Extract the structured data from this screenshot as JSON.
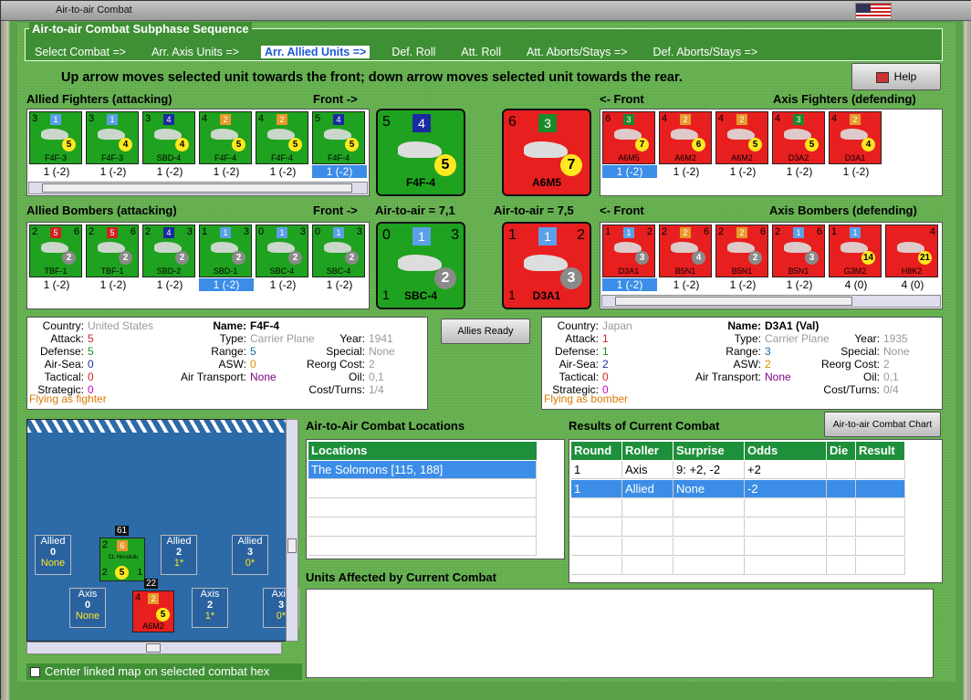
{
  "window": {
    "title": "Air-to-air Combat"
  },
  "sequence": {
    "header": "Air-to-air Combat Subphase Sequence",
    "steps": [
      "Select Combat =>",
      "Arr. Axis Units =>",
      "Arr. Allied Units =>",
      "Def. Roll",
      "Att. Roll",
      "Att. Aborts/Stays =>",
      "Def. Aborts/Stays =>"
    ],
    "active": 2
  },
  "instruction": "Up arrow moves selected unit towards the front; down arrow moves selected unit towards the rear.",
  "help_label": "Help",
  "labels": {
    "allied_fighters": "Allied Fighters (attacking)",
    "front_right": "Front ->",
    "front_left": "<- Front",
    "axis_fighters": "Axis Fighters (defending)",
    "allied_bombers": "Allied Bombers (attacking)",
    "axis_bombers": "Axis Bombers (defending)",
    "allied_a2a": "Air-to-air = 7,1",
    "axis_a2a": "Air-to-air = 7,5"
  },
  "allied_fighters": [
    {
      "tl": "3",
      "tr": "",
      "sq": "1",
      "name": "F4F-3",
      "circle": "5",
      "odds": "1 (-2)"
    },
    {
      "tl": "3",
      "tr": "",
      "sq": "1",
      "name": "F4F-3",
      "circle": "4",
      "odds": "1 (-2)"
    },
    {
      "tl": "3",
      "tr": "",
      "sq": "4",
      "name": "SBD-4",
      "circle": "4",
      "odds": "1 (-2)"
    },
    {
      "tl": "4",
      "tr": "",
      "sq": "2",
      "name": "F4F-4",
      "circle": "5",
      "odds": "1 (-2)"
    },
    {
      "tl": "4",
      "tr": "",
      "sq": "2",
      "name": "F4F-4",
      "circle": "5",
      "odds": "1 (-2)"
    },
    {
      "tl": "5",
      "tr": "",
      "sq": "4",
      "name": "F4F-4",
      "circle": "5",
      "odds": "1 (-2)"
    }
  ],
  "allied_bombers": [
    {
      "tl": "2",
      "tr": "6",
      "sq": "5",
      "name": "TBF-1",
      "circle": "2",
      "odds": "1 (-2)"
    },
    {
      "tl": "2",
      "tr": "6",
      "sq": "5",
      "name": "TBF-1",
      "circle": "2",
      "odds": "1 (-2)"
    },
    {
      "tl": "2",
      "tr": "3",
      "sq": "4",
      "name": "SBD-2",
      "circle": "2",
      "odds": "1 (-2)"
    },
    {
      "tl": "1",
      "tr": "3",
      "sq": "1",
      "name": "SBD-1",
      "circle": "2",
      "odds": "1 (-2)"
    },
    {
      "tl": "0",
      "tr": "3",
      "sq": "1",
      "name": "SBC-4",
      "circle": "2",
      "odds": "1 (-2)"
    },
    {
      "tl": "0",
      "tr": "3",
      "sq": "1",
      "name": "SBC-4",
      "circle": "2",
      "odds": "1 (-2)"
    }
  ],
  "axis_fighters": [
    {
      "tl": "6",
      "tr": "",
      "sq": "3",
      "name": "A6M5",
      "circle": "7",
      "odds": "1 (-2)"
    },
    {
      "tl": "4",
      "tr": "",
      "sq": "2",
      "name": "A6M2",
      "circle": "6",
      "odds": "1 (-2)"
    },
    {
      "tl": "4",
      "tr": "",
      "sq": "2",
      "name": "A6M2",
      "circle": "5",
      "odds": "1 (-2)"
    },
    {
      "tl": "4",
      "tr": "",
      "sq": "3",
      "name": "D3A2",
      "circle": "5",
      "odds": "1 (-2)"
    },
    {
      "tl": "4",
      "tr": "",
      "sq": "2",
      "name": "D3A1",
      "circle": "4",
      "odds": "1 (-2)"
    }
  ],
  "axis_bombers": [
    {
      "tl": "1",
      "tr": "2",
      "sq": "1",
      "name": "D3A1",
      "circle": "3",
      "odds": "1 (-2)"
    },
    {
      "tl": "2",
      "tr": "6",
      "sq": "2",
      "name": "B5N1",
      "circle": "4",
      "odds": "1 (-2)"
    },
    {
      "tl": "2",
      "tr": "6",
      "sq": "2",
      "name": "B5N1",
      "circle": "2",
      "odds": "1 (-2)"
    },
    {
      "tl": "2",
      "tr": "6",
      "sq": "1",
      "name": "B5N1",
      "circle": "3",
      "odds": "1 (-2)"
    },
    {
      "tl": "1",
      "tr": "",
      "sq": "1",
      "name": "G3M2",
      "circle": "14",
      "odds": "4 (0)"
    },
    {
      "tl": "",
      "tr": "4",
      "sq": "",
      "name": "H8K2",
      "circle": "21",
      "odds": "4 (0)"
    }
  ],
  "big_allied_fighter": {
    "tl": "5",
    "sq": "4",
    "circle": "5",
    "name": "F4F-4"
  },
  "big_axis_fighter": {
    "tl": "6",
    "sq": "3",
    "circle": "7",
    "name": "A6M5"
  },
  "big_allied_bomber": {
    "tl": "0",
    "sq": "1",
    "tr": "3",
    "circle": "2",
    "bl": "1",
    "name": "SBC-4"
  },
  "big_axis_bomber": {
    "tl": "1",
    "sq": "1",
    "tr": "2",
    "circle": "3",
    "bl": "1",
    "name": "D3A1"
  },
  "allies_ready": "Allies Ready",
  "allied_info": {
    "country_l": "Country:",
    "country": "United States",
    "attack_l": "Attack:",
    "attack": "5",
    "defense_l": "Defense:",
    "defense": "5",
    "airsea_l": "Air-Sea:",
    "airsea": "0",
    "tactical_l": "Tactical:",
    "tactical": "0",
    "strategic_l": "Strategic:",
    "strategic": "0",
    "role": "Flying as fighter",
    "name_l": "Name:",
    "name": "F4F-4",
    "type_l": "Type:",
    "type": "Carrier Plane",
    "range_l": "Range:",
    "range": "5",
    "asw_l": "ASW:",
    "asw": "0",
    "airtrans_l": "Air Transport:",
    "airtrans": "None",
    "year_l": "Year:",
    "year": "1941",
    "special_l": "Special:",
    "special": "None",
    "reorg_l": "Reorg Cost:",
    "reorg": "2",
    "oil_l": "Oil:",
    "oil": "0,1",
    "cost_l": "Cost/Turns:",
    "cost": "1/4"
  },
  "axis_info": {
    "country_l": "Country:",
    "country": "Japan",
    "attack_l": "Attack:",
    "attack": "1",
    "defense_l": "Defense:",
    "defense": "1",
    "airsea_l": "Air-Sea:",
    "airsea": "2",
    "tactical_l": "Tactical:",
    "tactical": "0",
    "strategic_l": "Strategic:",
    "strategic": "0",
    "role": "Flying as bomber",
    "name_l": "Name:",
    "name": "D3A1 (Val)",
    "type_l": "Type:",
    "type": "Carrier Plane",
    "range_l": "Range:",
    "range": "3",
    "asw_l": "ASW:",
    "asw": "2",
    "airtrans_l": "Air Transport:",
    "airtrans": "None",
    "year_l": "Year:",
    "year": "1935",
    "special_l": "Special:",
    "special": "None",
    "reorg_l": "Reorg Cost:",
    "reorg": "2",
    "oil_l": "Oil:",
    "oil": "0,1",
    "cost_l": "Cost/Turns:",
    "cost": "0/4"
  },
  "map": {
    "allied": [
      {
        "label": "Allied",
        "n": "0",
        "s": "None"
      },
      {
        "label": "Allied",
        "n": "2",
        "s": "1*"
      },
      {
        "label": "Allied",
        "n": "3",
        "s": "0*"
      }
    ],
    "axis": [
      {
        "label": "Axis",
        "n": "0",
        "s": "None"
      },
      {
        "label": "Axis",
        "n": "2",
        "s": "1*"
      },
      {
        "label": "Axis",
        "n": "3",
        "s": "0*"
      }
    ],
    "top_num": "61",
    "bot_num": "22",
    "ship_name": "CL Honolulu",
    "ship_tl": "2",
    "ship_sq": "6",
    "ship_circle": "5",
    "ship_bl": "2",
    "ship_br": "1",
    "axis_tl": "4",
    "axis_sq": "2",
    "axis_circle": "5",
    "axis_name": "A6M2"
  },
  "center_map_label": "Center linked map on selected combat hex",
  "locations": {
    "title": "Air-to-Air Combat Locations",
    "header": "Locations",
    "rows": [
      "The Solomons [115, 188]"
    ]
  },
  "results": {
    "title": "Results of Current Combat",
    "chart_btn": "Air-to-air Combat Chart",
    "headers": [
      "Round",
      "Roller",
      "Surprise",
      "Odds",
      "Die",
      "Result"
    ],
    "rows": [
      [
        "1",
        "Axis",
        "9: +2, -2",
        "+2",
        "",
        ""
      ],
      [
        "1",
        "Allied",
        "None",
        "-2",
        "",
        ""
      ]
    ]
  },
  "affected": {
    "title": "Units Affected by Current Combat"
  }
}
